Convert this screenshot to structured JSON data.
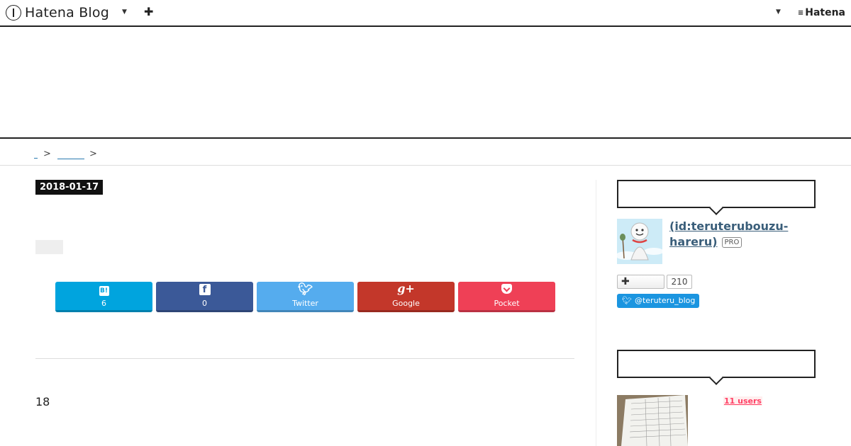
{
  "topbar": {
    "logo_text": "Hatena Blog",
    "brand_text": "Hatena"
  },
  "entry": {
    "date": "2018-01-17",
    "body_text": "18"
  },
  "share": [
    {
      "label": "6",
      "icon": "hatena-bookmark-icon"
    },
    {
      "label": "0",
      "icon": "facebook-icon"
    },
    {
      "label": "Twitter",
      "icon": "twitter-icon"
    },
    {
      "label": "Google",
      "icon": "google-plus-icon"
    },
    {
      "label": "Pocket",
      "icon": "pocket-icon"
    }
  ],
  "profile": {
    "name": " (id:teruterubouzu-hareru)",
    "pro_label": "PRO",
    "follow_count": "210",
    "twitter_handle": "@teruteru_blog"
  },
  "related": {
    "users_label": "11 users"
  },
  "colors": {
    "hatena_bookmark": "#00a4de",
    "facebook": "#3b5998",
    "twitter": "#55acee",
    "google": "#c3372a",
    "pocket": "#ef4056"
  }
}
